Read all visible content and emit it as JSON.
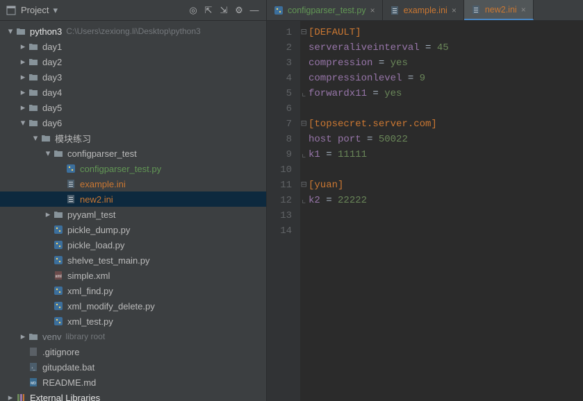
{
  "sidebar": {
    "title": "Project",
    "toolbar_icons": [
      "target-icon",
      "collapse-icon",
      "expand-icon",
      "gear-icon",
      "minimize-icon"
    ]
  },
  "tree": [
    {
      "depth": 0,
      "arrow": "down",
      "icon": "folder",
      "label": "python3",
      "suffix": "C:\\Users\\zexiong.li\\Desktop\\python3",
      "cls": "lbl-white"
    },
    {
      "depth": 1,
      "arrow": "right",
      "icon": "folder",
      "label": "day1"
    },
    {
      "depth": 1,
      "arrow": "right",
      "icon": "folder",
      "label": "day2"
    },
    {
      "depth": 1,
      "arrow": "right",
      "icon": "folder",
      "label": "day3"
    },
    {
      "depth": 1,
      "arrow": "right",
      "icon": "folder",
      "label": "day4"
    },
    {
      "depth": 1,
      "arrow": "right",
      "icon": "folder",
      "label": "day5"
    },
    {
      "depth": 1,
      "arrow": "down",
      "icon": "folder",
      "label": "day6"
    },
    {
      "depth": 2,
      "arrow": "down",
      "icon": "folder",
      "label": "模块练习"
    },
    {
      "depth": 3,
      "arrow": "down",
      "icon": "folder",
      "label": "configparser_test"
    },
    {
      "depth": 4,
      "arrow": "",
      "icon": "python",
      "label": "configparser_test.py",
      "cls": "lbl-green"
    },
    {
      "depth": 4,
      "arrow": "",
      "icon": "ini",
      "label": "example.ini",
      "cls": "lbl-orange"
    },
    {
      "depth": 4,
      "arrow": "",
      "icon": "ini",
      "label": "new2.ini",
      "cls": "lbl-orange",
      "selected": true
    },
    {
      "depth": 3,
      "arrow": "right",
      "icon": "folder",
      "label": "pyyaml_test"
    },
    {
      "depth": 3,
      "arrow": "",
      "icon": "python",
      "label": "pickle_dump.py"
    },
    {
      "depth": 3,
      "arrow": "",
      "icon": "python",
      "label": "pickle_load.py"
    },
    {
      "depth": 3,
      "arrow": "",
      "icon": "python",
      "label": "shelve_test_main.py"
    },
    {
      "depth": 3,
      "arrow": "",
      "icon": "xml",
      "label": "simple.xml"
    },
    {
      "depth": 3,
      "arrow": "",
      "icon": "python",
      "label": "xml_find.py"
    },
    {
      "depth": 3,
      "arrow": "",
      "icon": "python",
      "label": "xml_modify_delete.py"
    },
    {
      "depth": 3,
      "arrow": "",
      "icon": "python",
      "label": "xml_test.py"
    },
    {
      "depth": 1,
      "arrow": "right",
      "icon": "folder",
      "label": "venv",
      "suffix": "library root",
      "dim": true
    },
    {
      "depth": 1,
      "arrow": "",
      "icon": "file",
      "label": ".gitignore"
    },
    {
      "depth": 1,
      "arrow": "",
      "icon": "bat",
      "label": "gitupdate.bat"
    },
    {
      "depth": 1,
      "arrow": "",
      "icon": "md",
      "label": "README.md"
    },
    {
      "depth": 0,
      "arrow": "right",
      "icon": "lib",
      "label": "External Libraries",
      "cls": "lbl-white"
    }
  ],
  "tabs": [
    {
      "icon": "python",
      "label": "configparser_test.py",
      "cls": "lbl-green",
      "active": false
    },
    {
      "icon": "ini",
      "label": "example.ini",
      "cls": "lbl-orange",
      "active": false
    },
    {
      "icon": "ini",
      "label": "new2.ini",
      "cls": "lbl-orange",
      "active": true
    }
  ],
  "code": [
    {
      "n": 1,
      "tokens": [
        {
          "t": "[DEFAULT]",
          "c": "tok-section"
        }
      ],
      "fold": "open"
    },
    {
      "n": 2,
      "tokens": [
        {
          "t": "serveraliveinterval",
          "c": "tok-key"
        },
        {
          "t": " = ",
          "c": "tok-eq"
        },
        {
          "t": "45",
          "c": "tok-val"
        }
      ]
    },
    {
      "n": 3,
      "tokens": [
        {
          "t": "compression",
          "c": "tok-key"
        },
        {
          "t": " = ",
          "c": "tok-eq"
        },
        {
          "t": "yes",
          "c": "tok-val"
        }
      ]
    },
    {
      "n": 4,
      "tokens": [
        {
          "t": "compressionlevel",
          "c": "tok-key"
        },
        {
          "t": " = ",
          "c": "tok-eq"
        },
        {
          "t": "9",
          "c": "tok-val"
        }
      ]
    },
    {
      "n": 5,
      "tokens": [
        {
          "t": "forwardx11",
          "c": "tok-key"
        },
        {
          "t": " = ",
          "c": "tok-eq"
        },
        {
          "t": "yes",
          "c": "tok-val"
        }
      ],
      "fold": "close"
    },
    {
      "n": 6,
      "tokens": []
    },
    {
      "n": 7,
      "tokens": [
        {
          "t": "[topsecret.server.com]",
          "c": "tok-section"
        }
      ],
      "fold": "open"
    },
    {
      "n": 8,
      "tokens": [
        {
          "t": "host port",
          "c": "tok-key"
        },
        {
          "t": " = ",
          "c": "tok-eq"
        },
        {
          "t": "50022",
          "c": "tok-val"
        }
      ]
    },
    {
      "n": 9,
      "tokens": [
        {
          "t": "k1",
          "c": "tok-key"
        },
        {
          "t": " = ",
          "c": "tok-eq"
        },
        {
          "t": "11111",
          "c": "tok-val"
        }
      ],
      "fold": "close"
    },
    {
      "n": 10,
      "tokens": []
    },
    {
      "n": 11,
      "tokens": [
        {
          "t": "[yuan]",
          "c": "tok-section"
        }
      ],
      "fold": "open"
    },
    {
      "n": 12,
      "tokens": [
        {
          "t": "k2",
          "c": "tok-key"
        },
        {
          "t": " = ",
          "c": "tok-eq"
        },
        {
          "t": "22222",
          "c": "tok-val"
        }
      ],
      "fold": "close"
    },
    {
      "n": 13,
      "tokens": []
    },
    {
      "n": 14,
      "tokens": []
    }
  ],
  "icon_glyphs": {
    "target-icon": "◎",
    "collapse-icon": "⇱",
    "expand-icon": "⇲",
    "gear-icon": "⚙",
    "minimize-icon": "—"
  }
}
